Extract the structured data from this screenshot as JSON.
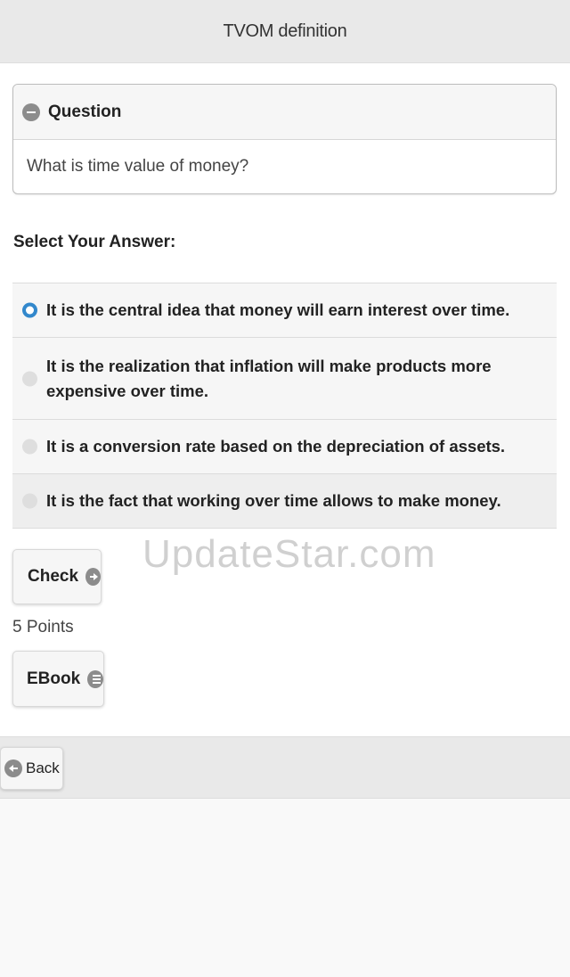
{
  "header": {
    "title": "TVOM definition"
  },
  "question": {
    "heading": "Question",
    "text": "What is time value of money?"
  },
  "prompt": "Select Your Answer:",
  "answers": [
    {
      "label": "It is the central idea that money will earn interest over time.",
      "selected": true
    },
    {
      "label": "It is the realization that inflation will make products more expensive over time.",
      "selected": false
    },
    {
      "label": "It is a conversion rate based on the depreciation of assets.",
      "selected": false
    },
    {
      "label": "It is the fact that working over time allows to make money.",
      "selected": false
    }
  ],
  "actions": {
    "check_label": "Check",
    "points_label": "5 Points",
    "ebook_label": "EBook"
  },
  "footer": {
    "back_label": "Back"
  },
  "watermark": "UpdateStar.com",
  "colors": {
    "selected_radio": "#3388cc",
    "header_bg": "#e9e9e9",
    "icon_gray": "#8c8c8c"
  }
}
